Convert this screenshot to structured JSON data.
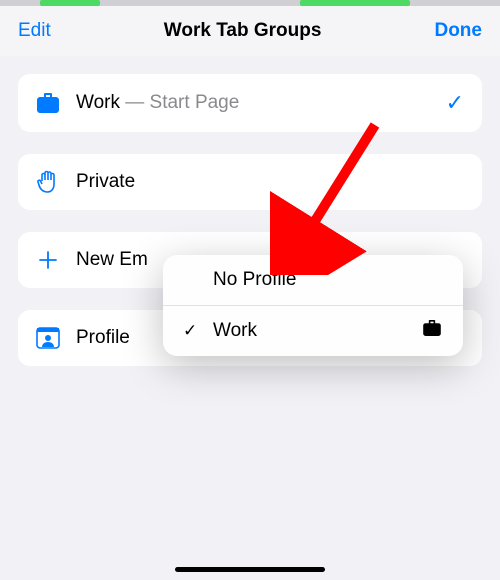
{
  "header": {
    "edit": "Edit",
    "title": "Work Tab Groups",
    "done": "Done"
  },
  "rows": {
    "work": {
      "label": "Work",
      "sublabel": " — Start Page"
    },
    "private": {
      "label": "Private"
    },
    "newGroup": {
      "label": "New Em"
    },
    "profile": {
      "label": "Profile",
      "value": "Work"
    }
  },
  "popup": {
    "noProfile": "No Profile",
    "work": "Work"
  },
  "colors": {
    "accent": "#007aff",
    "red": "#ff0000"
  }
}
